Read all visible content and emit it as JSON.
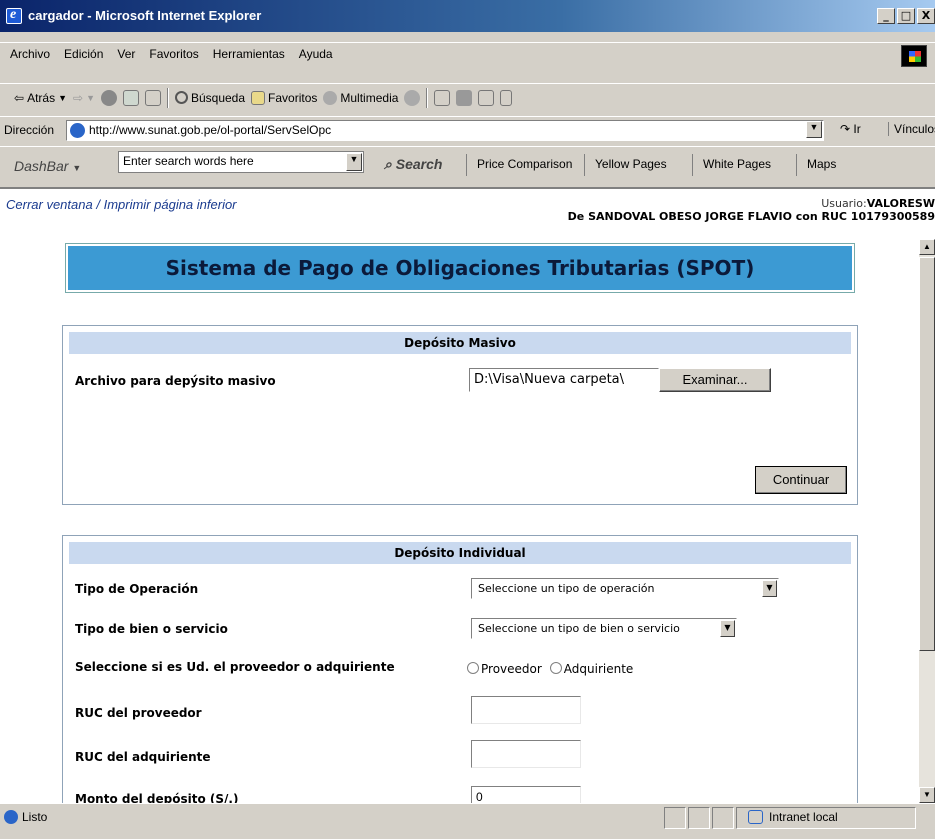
{
  "window": {
    "title": "cargador - Microsoft Internet Explorer",
    "btn_min": "_",
    "btn_max": "□",
    "btn_close": "X"
  },
  "menu": [
    "Archivo",
    "Edición",
    "Ver",
    "Favoritos",
    "Herramientas",
    "Ayuda"
  ],
  "toolbar": {
    "back": "Atrás",
    "search": "Búsqueda",
    "favorites": "Favoritos",
    "media": "Multimedia"
  },
  "address": {
    "label": "Dirección",
    "url": "http://www.sunat.gob.pe/ol-portal/ServSelOpc",
    "go": "Ir",
    "links": "Vínculos"
  },
  "dashbar": {
    "logo": "DashBar",
    "search_placeholder": "Enter search words here",
    "search_button": "Search",
    "links": [
      "Price Comparison",
      "Yellow Pages",
      "White Pages",
      "Maps"
    ]
  },
  "page": {
    "close_window": "Cerrar ventana",
    "print_page": "Imprimir página inferior",
    "user_label": "Usuario:",
    "user_name": "VALORESW",
    "user_detail": "De SANDOVAL OBESO JORGE FLAVIO con RUC 10179300589",
    "banner_title": "Sistema de Pago de Obligaciones Tributarias (SPOT)"
  },
  "masivo": {
    "header": "Depósito Masivo",
    "file_label": "Archivo para depýsito masivo",
    "file_value": "D:\\Visa\\Nueva carpeta\\",
    "browse": "Examinar...",
    "continue": "Continuar"
  },
  "individual": {
    "header": "Depósito Individual",
    "tipo_operacion_label": "Tipo de Operación",
    "tipo_operacion_value": "Seleccione un tipo de operación",
    "tipo_bien_label": "Tipo de bien o servicio",
    "tipo_bien_value": "Seleccione un tipo de bien o servicio",
    "rol_label": "Seleccione si es Ud. el proveedor o adquiriente",
    "rol_proveedor": "Proveedor",
    "rol_adquiriente": "Adquiriente",
    "ruc_proveedor_label": "RUC del proveedor",
    "ruc_adquiriente_label": "RUC del adquiriente",
    "monto_label": "Monto del depósito (S/.)",
    "monto_value": "0"
  },
  "status": {
    "text": "Listo",
    "zone": "Intranet local"
  }
}
